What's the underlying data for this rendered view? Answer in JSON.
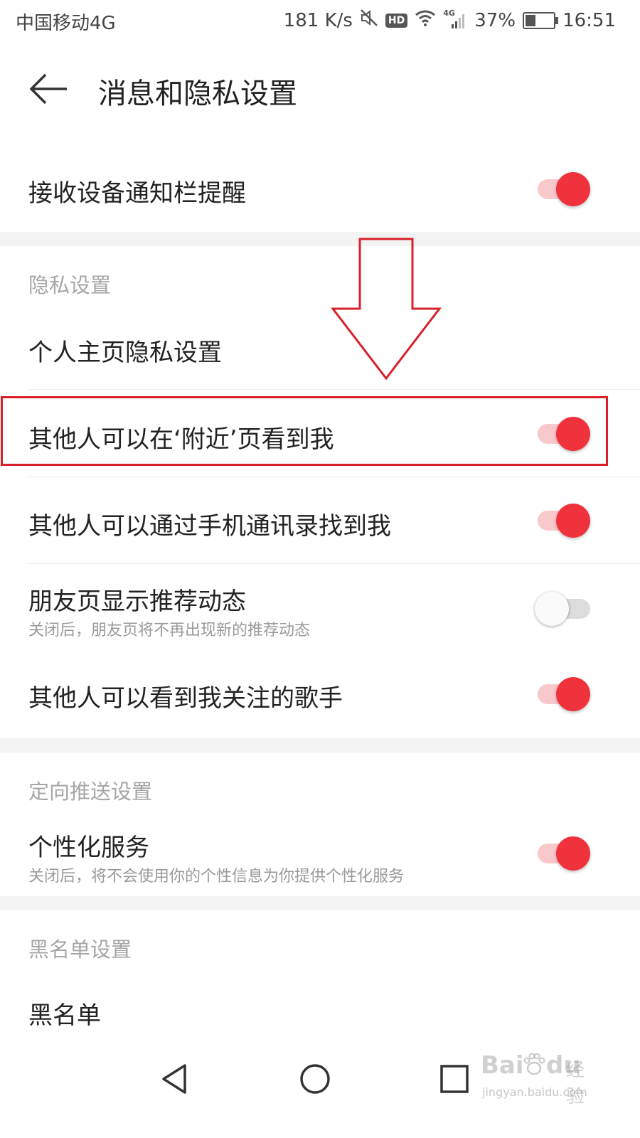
{
  "status_bar": {
    "carrier": "中国移动4G",
    "speed": "181 K/s",
    "hd_badge": "HD",
    "net_tag": "4G",
    "battery": "37%",
    "battery_level": 0.37,
    "time": "16:51",
    "icons": [
      "mute-icon",
      "hd-icon",
      "wifi-icon",
      "signal-icon",
      "battery-icon"
    ]
  },
  "header": {
    "title": "消息和隐私设置",
    "back_icon": "arrow-left-icon"
  },
  "notification": {
    "label": "接收设备通知栏提醒",
    "enabled": true
  },
  "privacy": {
    "section_title": "隐私设置",
    "homepage_label": "个人主页隐私设置",
    "items": [
      {
        "label": "其他人可以在‘附近’页看到我",
        "enabled": true,
        "highlighted": true
      },
      {
        "label": "其他人可以通过手机通讯录找到我",
        "enabled": true
      },
      {
        "label": "朋友页显示推荐动态",
        "sub": "关闭后，朋友页将不再出现新的推荐动态",
        "enabled": false
      },
      {
        "label": "其他人可以看到我关注的歌手",
        "enabled": true
      }
    ]
  },
  "targeted": {
    "section_title": "定向推送设置",
    "label": "个性化服务",
    "sub": "关闭后，将不会使用你的个性信息为你提供个性化服务",
    "enabled": true
  },
  "blacklist": {
    "section_title": "黑名单设置",
    "label": "黑名单"
  },
  "nav_bar": {
    "icons": [
      "nav-back-icon",
      "nav-home-icon",
      "nav-recents-icon"
    ]
  },
  "watermark": {
    "brand": "Bai",
    "brand2": "du",
    "tag": "经验",
    "url": "jingyan.baidu.com"
  },
  "colors": {
    "accent": "#f0323c",
    "track_on": "#f9c8cb",
    "annotation": "#d8202a",
    "section_gap": "#f3f3f3"
  }
}
